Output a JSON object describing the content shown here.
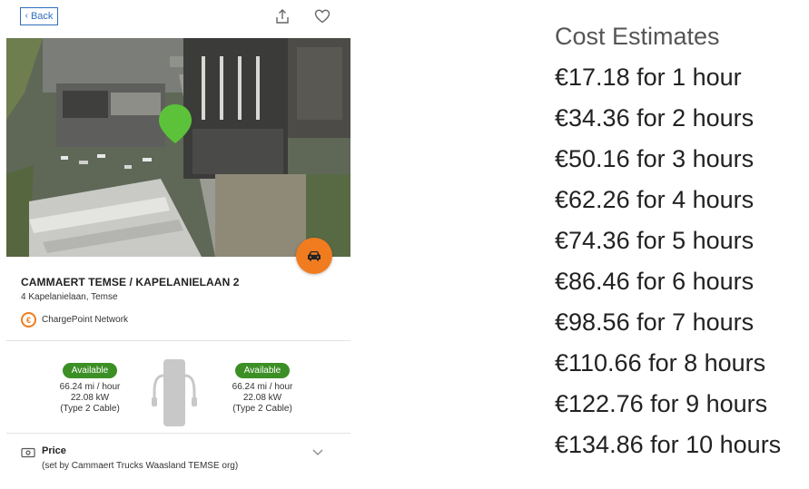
{
  "header": {
    "back_label": "Back",
    "share_icon": "share-icon",
    "favorite_icon": "heart-icon"
  },
  "station": {
    "name": "CAMMAERT TEMSE / KAPELANIELAAN 2",
    "address": "4 Kapelanielaan, Temse",
    "network": "ChargePoint Network",
    "network_logo_glyph": "€"
  },
  "ports": [
    {
      "status": "Available",
      "speed": "66.24 mi / hour",
      "power": "22.08 kW",
      "connector": "(Type 2 Cable)"
    },
    {
      "status": "Available",
      "speed": "66.24 mi / hour",
      "power": "22.08 kW",
      "connector": "(Type 2 Cable)"
    }
  ],
  "price": {
    "title": "Price",
    "subtitle": "(set by Cammaert Trucks Waasland TEMSE org)"
  },
  "estimates": {
    "title": "Cost Estimates",
    "items": [
      "€17.18 for 1 hour",
      "€34.36 for 2 hours",
      "€50.16 for 3 hours",
      "€62.26 for 4 hours",
      "€74.36 for 5 hours",
      "€86.46 for 6 hours",
      "€98.56 for 7 hours",
      "€110.66 for 8 hours",
      "€122.76 for 9 hours",
      "€134.86 for 10 hours"
    ]
  },
  "colors": {
    "accent_blue": "#2f6fbf",
    "status_green": "#3c8f25",
    "pin_green": "#5cc23a",
    "orange": "#f07c1f"
  }
}
